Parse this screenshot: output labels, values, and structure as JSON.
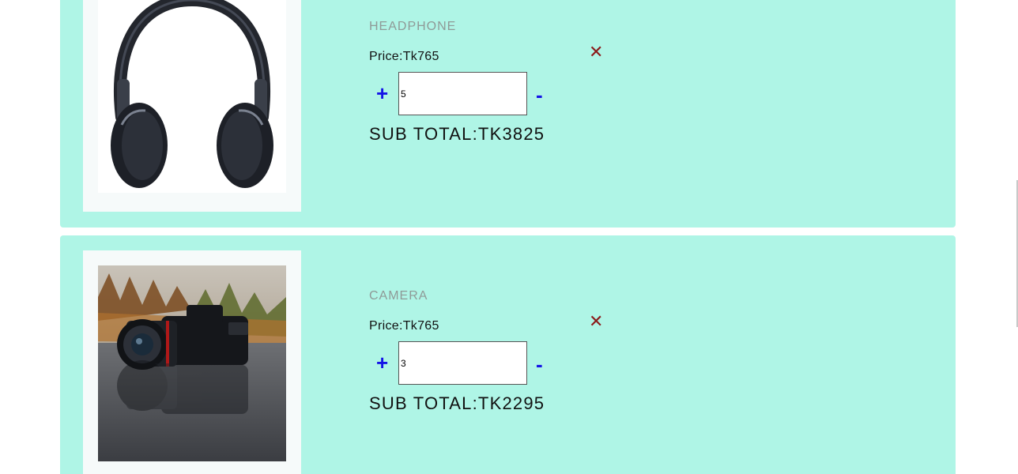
{
  "cart": {
    "items": [
      {
        "name": "HEADPHONE",
        "price": "Price:Tk765",
        "quantity": "5",
        "subtotal": "SUB TOTAL:TK3825",
        "remove_icon": "close-icon",
        "increment_label": "+",
        "decrement_label": "-",
        "image_icon": "headphone-image"
      },
      {
        "name": "CAMERA",
        "price": "Price:Tk765",
        "quantity": "3",
        "subtotal": "SUB TOTAL:TK2295",
        "remove_icon": "close-icon",
        "increment_label": "+",
        "decrement_label": "-",
        "image_icon": "camera-image"
      }
    ],
    "remove_glyph": "✕"
  },
  "colors": {
    "card_background": "#aff5e6",
    "image_frame": "#f6fafa",
    "stepper_blue": "#1414e6",
    "remove_red": "#8b1a1a",
    "product_name_gray": "#8f9a97"
  }
}
